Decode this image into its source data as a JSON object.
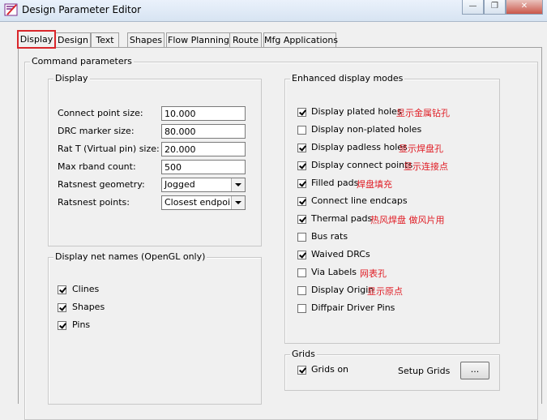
{
  "window": {
    "title": "Design Parameter Editor",
    "minimize_glyph": "—",
    "restore_glyph": "❐",
    "close_glyph": "✕"
  },
  "tabs": [
    "Display",
    "Design",
    "Text",
    "Shapes",
    "Flow Planning",
    "Route",
    "Mfg Applications"
  ],
  "command_parameters": {
    "title": "Command parameters",
    "display": {
      "title": "Display",
      "connect_point_size": {
        "label": "Connect point size:",
        "value": "10.000"
      },
      "drc_marker_size": {
        "label": "DRC marker size:",
        "value": "80.000"
      },
      "rat_t_size": {
        "label": "Rat T (Virtual pin) size:",
        "value": "20.000"
      },
      "max_rband_count": {
        "label": "Max rband count:",
        "value": "500"
      },
      "ratsnest_geometry": {
        "label": "Ratsnest geometry:",
        "value": "Jogged"
      },
      "ratsnest_points": {
        "label": "Ratsnest points:",
        "value": "Closest endpoint"
      }
    },
    "net_names": {
      "title": "Display net names (OpenGL only)",
      "items": [
        {
          "label": "Clines",
          "checked": true
        },
        {
          "label": "Shapes",
          "checked": true
        },
        {
          "label": "Pins",
          "checked": true
        }
      ]
    },
    "enhanced": {
      "title": "Enhanced display modes",
      "items": [
        {
          "label": "Display plated holes",
          "checked": true,
          "note": "显示金属钻孔"
        },
        {
          "label": "Display non-plated holes",
          "checked": false,
          "note": ""
        },
        {
          "label": "Display padless holes",
          "checked": true,
          "note": "显示焊盘孔"
        },
        {
          "label": "Display connect points",
          "checked": true,
          "note": "显示连接点"
        },
        {
          "label": "Filled pads",
          "checked": true,
          "note": "焊盘填充"
        },
        {
          "label": "Connect line endcaps",
          "checked": true,
          "note": ""
        },
        {
          "label": "Thermal pads",
          "checked": true,
          "note": "热风焊盘 做风片用"
        },
        {
          "label": "Bus rats",
          "checked": false,
          "note": ""
        },
        {
          "label": "Waived DRCs",
          "checked": true,
          "note": ""
        },
        {
          "label": "Via Labels",
          "checked": false,
          "note": "网表孔"
        },
        {
          "label": "Display Origin",
          "checked": false,
          "note": "显示原点"
        },
        {
          "label": "Diffpair Driver Pins",
          "checked": false,
          "note": ""
        }
      ]
    },
    "grids": {
      "title": "Grids",
      "grids_on": {
        "label": "Grids on",
        "checked": true
      },
      "setup_label": "Setup Grids",
      "setup_button": "..."
    }
  }
}
